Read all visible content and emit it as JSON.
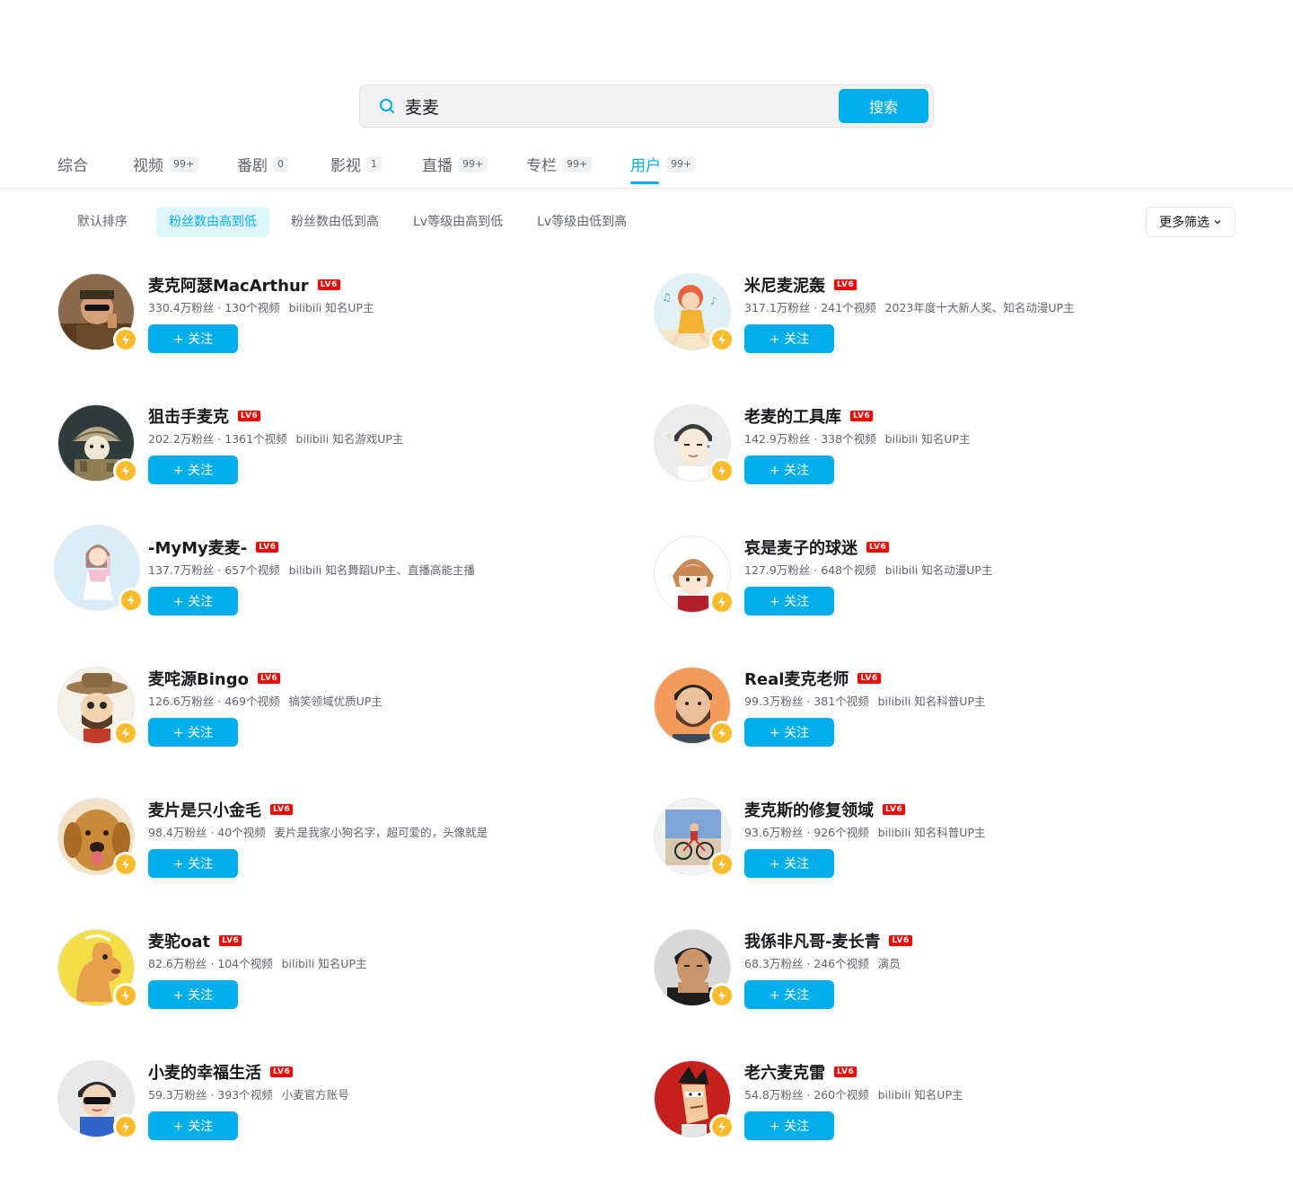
{
  "search": {
    "query": "麦麦",
    "button_label": "搜索"
  },
  "tabs": [
    {
      "label": "综合",
      "count": ""
    },
    {
      "label": "视频",
      "count": "99+"
    },
    {
      "label": "番剧",
      "count": "0"
    },
    {
      "label": "影视",
      "count": "1"
    },
    {
      "label": "直播",
      "count": "99+"
    },
    {
      "label": "专栏",
      "count": "99+"
    },
    {
      "label": "用户",
      "count": "99+",
      "active": true
    }
  ],
  "sorts": [
    {
      "label": "默认排序"
    },
    {
      "label": "粉丝数由高到低",
      "active": true
    },
    {
      "label": "粉丝数由低到高"
    },
    {
      "label": "Lv等级由高到低"
    },
    {
      "label": "Lv等级由低到高"
    }
  ],
  "more_filter": "更多筛选",
  "follow_label": "+ 关注",
  "lv_label": "LV6",
  "colors": {
    "accent": "#00aeec",
    "badge": "#fbbc2c",
    "lv": "#ff0000"
  },
  "users": [
    {
      "name": "麦克阿瑟MacArthur",
      "fans": "330.4万粉丝",
      "videos": "130个视频",
      "desc": "bilibili 知名UP主",
      "avatar": "man-sunglasses"
    },
    {
      "name": "米尼麦泥轰",
      "fans": "317.1万粉丝",
      "videos": "241个视频",
      "desc": "2023年度十大新人奖、知名动漫UP主",
      "avatar": "cartoon-girl"
    },
    {
      "name": "狙击手麦克",
      "fans": "202.2万粉丝",
      "videos": "1361个视频",
      "desc": "bilibili 知名游戏UP主",
      "avatar": "soldier-helmet"
    },
    {
      "name": "老麦的工具库",
      "fans": "142.9万粉丝",
      "videos": "338个视频",
      "desc": "bilibili 知名UP主",
      "avatar": "anime-man"
    },
    {
      "name": "-MyMy麦麦-",
      "fans": "137.7万粉丝",
      "videos": "657个视频",
      "desc": "bilibili 知名舞蹈UP主、直播高能主播",
      "avatar": "dancer-girl"
    },
    {
      "name": "哀是麦子的球迷",
      "fans": "127.9万粉丝",
      "videos": "648个视频",
      "desc": "bilibili 知名动漫UP主",
      "avatar": "anime-girl"
    },
    {
      "name": "麦咤源Bingo",
      "fans": "126.6万粉丝",
      "videos": "469个视频",
      "desc": "搞笑领域优质UP主",
      "avatar": "cowboy-cartoon"
    },
    {
      "name": "Real麦克老师",
      "fans": "99.3万粉丝",
      "videos": "381个视频",
      "desc": "bilibili 知名科普UP主",
      "avatar": "bearded-man"
    },
    {
      "name": "麦片是只小金毛",
      "fans": "98.4万粉丝",
      "videos": "40个视频",
      "desc": "麦片是我家小狗名字，超可爱的，头像就是",
      "avatar": "golden-retriever"
    },
    {
      "name": "麦克斯的修复领域",
      "fans": "93.6万粉丝",
      "videos": "926个视频",
      "desc": "bilibili 知名科普UP主",
      "avatar": "bicycle-poster"
    },
    {
      "name": "麦驼oat",
      "fans": "82.6万粉丝",
      "videos": "104个视频",
      "desc": "bilibili 知名UP主",
      "avatar": "camel-cartoon"
    },
    {
      "name": "我係非凡哥-麦长青",
      "fans": "68.3万粉丝",
      "videos": "246个视频",
      "desc": "演员",
      "avatar": "older-man"
    },
    {
      "name": "小麦的幸福生活",
      "fans": "59.3万粉丝",
      "videos": "393个视频",
      "desc": "小麦官方账号",
      "avatar": "kid-sunglasses"
    },
    {
      "name": "老六麦克雷",
      "fans": "54.8万粉丝",
      "videos": "260个视频",
      "desc": "bilibili 知名UP主",
      "avatar": "cartoon-man-red"
    }
  ]
}
